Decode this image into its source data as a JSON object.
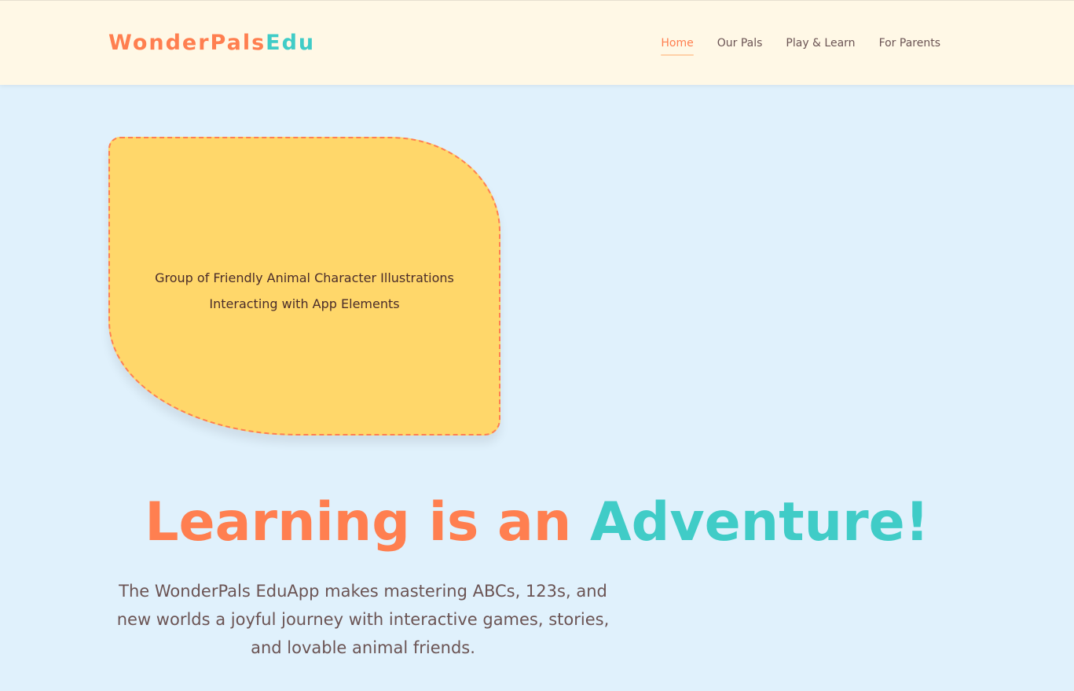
{
  "header": {
    "logo": {
      "part_a": "WonderPals",
      "part_b": "Edu"
    },
    "nav": [
      {
        "label": "Home",
        "active": true
      },
      {
        "label": "Our Pals",
        "active": false
      },
      {
        "label": "Play & Learn",
        "active": false
      },
      {
        "label": "For Parents",
        "active": false
      }
    ]
  },
  "hero": {
    "image_placeholder": "Group of Friendly Animal Character Illustrations Interacting with App Elements",
    "headline_a": "Learning is an",
    "headline_b": "Adventure!",
    "description": "The WonderPals EduApp makes mastering ABCs, 123s, and new worlds a joyful journey with interactive games, stories, and lovable animal friends."
  },
  "colors": {
    "accent_coral": "#ff7f50",
    "accent_teal": "#40ccc7",
    "header_bg": "#fff8e6",
    "page_bg": "#e0f1fc",
    "blob_fill": "#ffd76a",
    "body_text": "#6b5454"
  }
}
